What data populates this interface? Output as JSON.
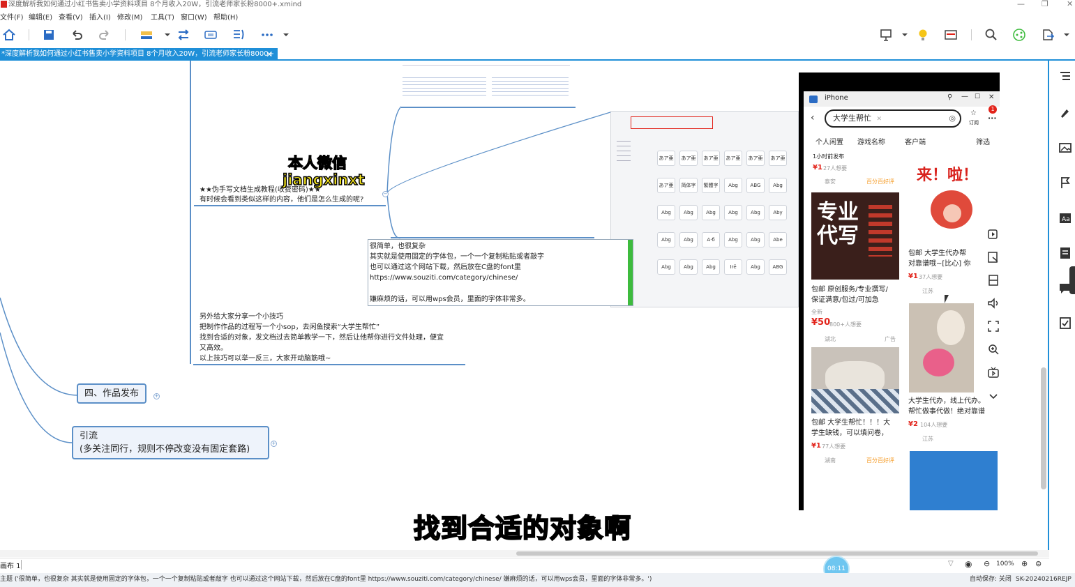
{
  "window": {
    "title": "深度解析我如何通过小红书售卖小学资料项目 8个月收入20W，引流老师家长粉8000+.xmind"
  },
  "menu": [
    "文件(F)",
    "编辑(E)",
    "查看(V)",
    "插入(I)",
    "修改(M)",
    "工具(T)",
    "窗口(W)",
    "帮助(H)"
  ],
  "tab": {
    "label": "*深度解析我如何通过小红书售卖小学资料项目 8个月收入20W，引流老师家长粉8000+",
    "close": "✕"
  },
  "mindmap": {
    "node_handwriting_line1": "★★伪手写文档生成教程(收费密码)★★",
    "node_handwriting_line2": "有时候会看到类似这样的内容，他们是怎么生成的呢?",
    "watermark_line1": "本人微信",
    "watermark_line2": "jiangxinxt",
    "answer_lines": [
      "很简单，也很复杂",
      "其实就是使用固定的字体包，一个一个复制粘贴或者敲字",
      "也可以通过这个网站下载，然后放在C盘的font里",
      "https://www.souziti.com/category/chinese/",
      "",
      "嫌麻烦的话，可以用wps会员，里面的字体非常多。"
    ],
    "tip_lines": [
      "另外给大家分享一个小技巧",
      "把制作作品的过程写一个小sop，去闲鱼搜索“大学生帮忙”",
      "找到合适的对象，发文档过去简单教学一下，然后让他帮你进行文件处理，便宜",
      "又高效。",
      "以上技巧可以举一反三，大家开动脑筋哦~"
    ],
    "topic_publish": "四、作品发布",
    "topic_traffic_line1": "引流",
    "topic_traffic_line2": "(多关注同行，规则不停改变没有固定套路)"
  },
  "font_samples": [
    "あア亜",
    "あア亜",
    "あア亜",
    "あア亜",
    "あア亜",
    "あア亜",
    "あア亜",
    "简体字",
    "繁體字",
    "Abg",
    "ABG",
    "Abg",
    "Abg",
    "Abg",
    "Abg",
    "Abg",
    "Abg",
    "Aby",
    "Abg",
    "Abg",
    "А·б",
    "Abg",
    "Abg",
    "Abe",
    "Abg",
    "Abg",
    "Abg",
    "Irē",
    "Abg",
    "ABG"
  ],
  "phone": {
    "window_title": "iPhone",
    "search_text": "大学生帮忙",
    "subscribe": "订阅",
    "filters": [
      "个人闲置",
      "游戏名称",
      "客户端",
      "筛选"
    ],
    "items": {
      "left1_time": "1小时前发布",
      "left1_price": "¥1",
      "left1_wants": "27人想要",
      "left1_loc": "泰安",
      "left1_badge": "百分百好评",
      "poster_big": "专业代写",
      "left2_title_1": "包邮 原创服务/专业撰写/",
      "left2_title_2": "保证满意/包过/可加急",
      "left2_new": "全新",
      "left2_price": "¥50",
      "left2_wants": "800+人想要",
      "left2_loc": "湖北",
      "left2_ad": "广告",
      "left3_title_1": "包邮 大学生帮忙！！！大",
      "left3_title_2": "学生缺钱，可以填问卷，",
      "left3_price": "¥1",
      "left3_wants": "77人想要",
      "left3_loc": "湖南",
      "left3_badge": "百分百好评",
      "right1_sticker": "来！啦！",
      "right1_title_1": "包邮 大学生代办帮",
      "right1_title_2": "对靠谱哦~[比心] 你",
      "right1_price": "¥1",
      "right1_wants": "37人想要",
      "right1_loc": "江苏",
      "right2_title_1": "大学生代办，线上代办。",
      "right2_title_2": "帮忙做事代做！绝对靠谱",
      "right2_price": "¥2",
      "right2_wants": "104人想要",
      "right2_loc": "江苏"
    }
  },
  "subtitle": "找到合适的对象啊",
  "sheet": {
    "label": "画布 1"
  },
  "zoom": "100%",
  "timer": "08:11",
  "status": {
    "text": "主题 ('很简单，也很复杂 其实就是使用固定的字体包，一个一个复制粘贴或者敲字 也可以通过这个网站下载，然后放在C盘的font里 https://www.souziti.com/category/chinese/ 嫌麻烦的话，可以用wps会员，里面的字体非常多。')",
    "autosave": "自动保存: 关闭",
    "machine": "SK-20240216REJP"
  },
  "colors": {
    "accent": "#1f8fd8",
    "topic_border": "#5b8fc7",
    "subtitle": "#f6e61b",
    "price_red": "#e2231a"
  }
}
